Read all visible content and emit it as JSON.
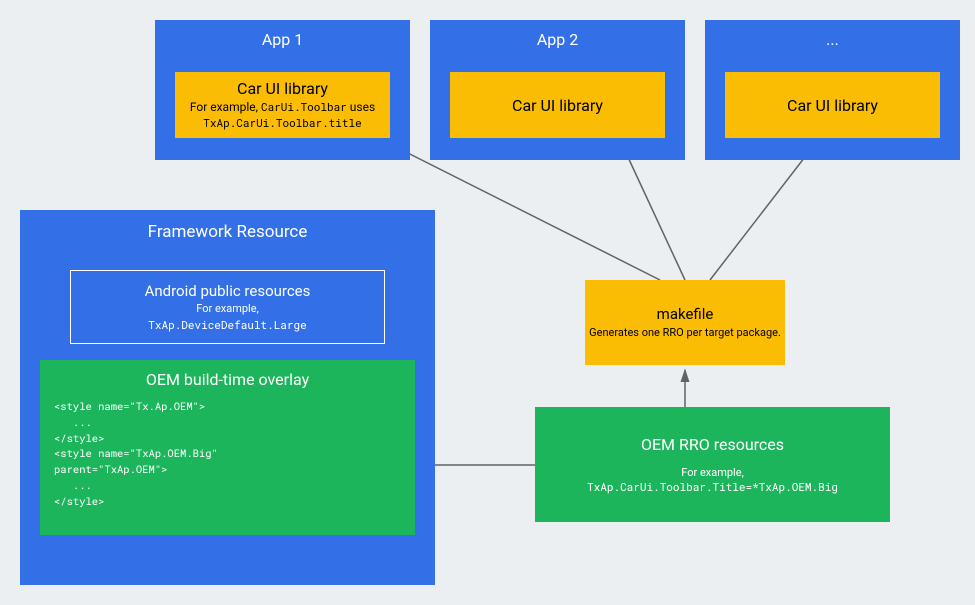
{
  "apps": [
    {
      "title": "App 1",
      "lib_title": "Car UI library",
      "lib_sub_prefix": "For example, ",
      "lib_sub_code1": "CarUi.Toolbar",
      "lib_sub_mid": " uses",
      "lib_sub_code2": "TxAp.CarUi.Toolbar.title"
    },
    {
      "title": "App 2",
      "lib_title": "Car UI library"
    },
    {
      "title": "...",
      "lib_title": "Car UI library"
    }
  ],
  "framework": {
    "title": "Framework Resource",
    "public": {
      "title": "Android public resources",
      "sub": "For example,",
      "code": "TxAp.DeviceDefault.Large"
    },
    "overlay": {
      "title": "OEM build-time overlay",
      "code": "<style name=\"Tx.Ap.OEM\">\n   ...\n</style>\n<style name=\"TxAp.OEM.Big\"\nparent=\"TxAp.OEM\">\n   ...\n</style>"
    }
  },
  "makefile": {
    "title": "makefile",
    "sub": "Generates one RRO per target package."
  },
  "rro": {
    "title": "OEM RRO resources",
    "sub": "For example,",
    "code": "TxAp.CarUi.Toolbar.Title=*TxAp.OEM.Big"
  }
}
